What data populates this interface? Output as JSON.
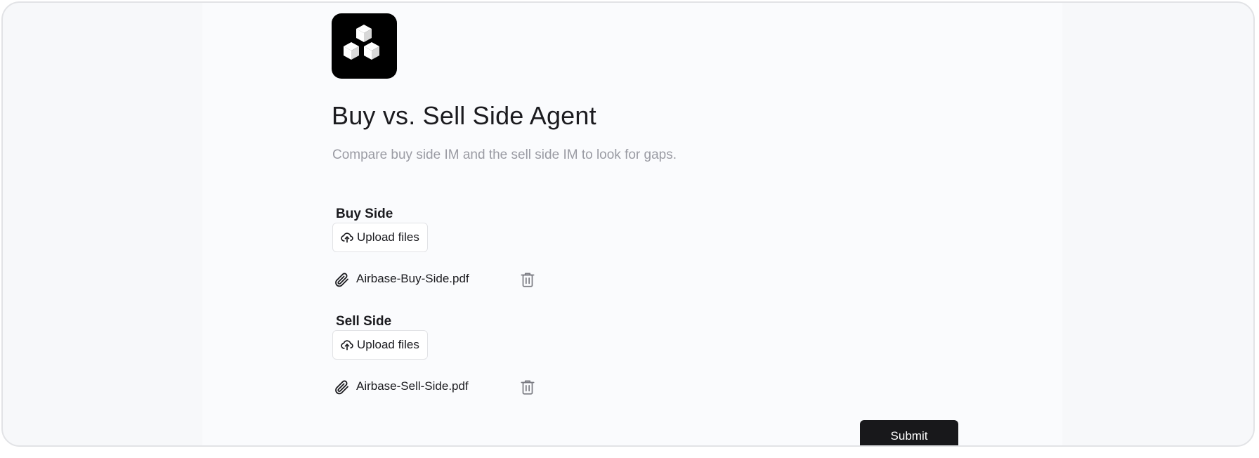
{
  "app": {
    "title": "Buy vs. Sell Side Agent",
    "description": "Compare buy side IM and the sell side IM to look for gaps.",
    "logo_icon": "isometric-cubes-logo"
  },
  "sections": [
    {
      "label": "Buy Side",
      "upload_label": "Upload files",
      "upload_icon": "cloud-upload-icon",
      "file": {
        "name": "Airbase-Buy-Side.pdf",
        "icon": "paperclip-icon",
        "delete_icon": "trash-icon"
      }
    },
    {
      "label": "Sell Side",
      "upload_label": "Upload files",
      "upload_icon": "cloud-upload-icon",
      "file": {
        "name": "Airbase-Sell-Side.pdf",
        "icon": "paperclip-icon",
        "delete_icon": "trash-icon"
      }
    }
  ],
  "submit": {
    "label": "Submit"
  },
  "colors": {
    "primary_button": "#18181b",
    "page_background": "#f7f8fa",
    "text": "#1b1b1f",
    "muted_text": "#9a9ba3"
  }
}
